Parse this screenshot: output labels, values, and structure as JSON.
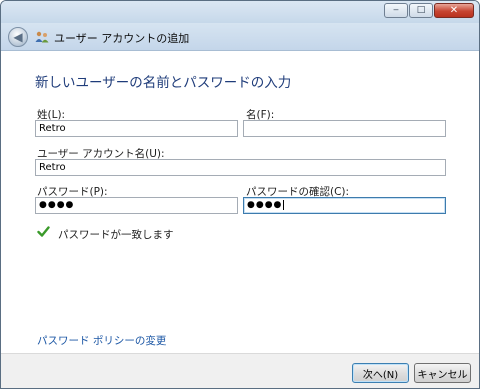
{
  "window": {
    "title": "ユーザー アカウントの追加",
    "caption_buttons": {
      "minimize": "‒",
      "maximize": "□",
      "close": "✕"
    }
  },
  "heading": "新しいユーザーの名前とパスワードの入力",
  "form": {
    "last_name": {
      "label": "姓(L):",
      "value": "Retro"
    },
    "first_name": {
      "label": "名(F):",
      "value": ""
    },
    "account_name": {
      "label": "ユーザー アカウント名(U):",
      "value": "Retro"
    },
    "password": {
      "label": "パスワード(P):",
      "value": "●●●●"
    },
    "password_confirm": {
      "label": "パスワードの確認(C):",
      "value": "●●●●"
    }
  },
  "status": {
    "text": "パスワードが一致します",
    "color": "#3a9a2a"
  },
  "links": {
    "password_policy": "パスワード ポリシーの変更"
  },
  "buttons": {
    "next": "次へ(N)",
    "cancel": "キャンセル"
  },
  "icons": {
    "back": "back-arrow-icon",
    "users": "users-icon",
    "check": "checkmark-icon"
  },
  "colors": {
    "heading": "#1f3c7a",
    "link": "#1c57a5",
    "focus_border": "#3d7bad"
  }
}
